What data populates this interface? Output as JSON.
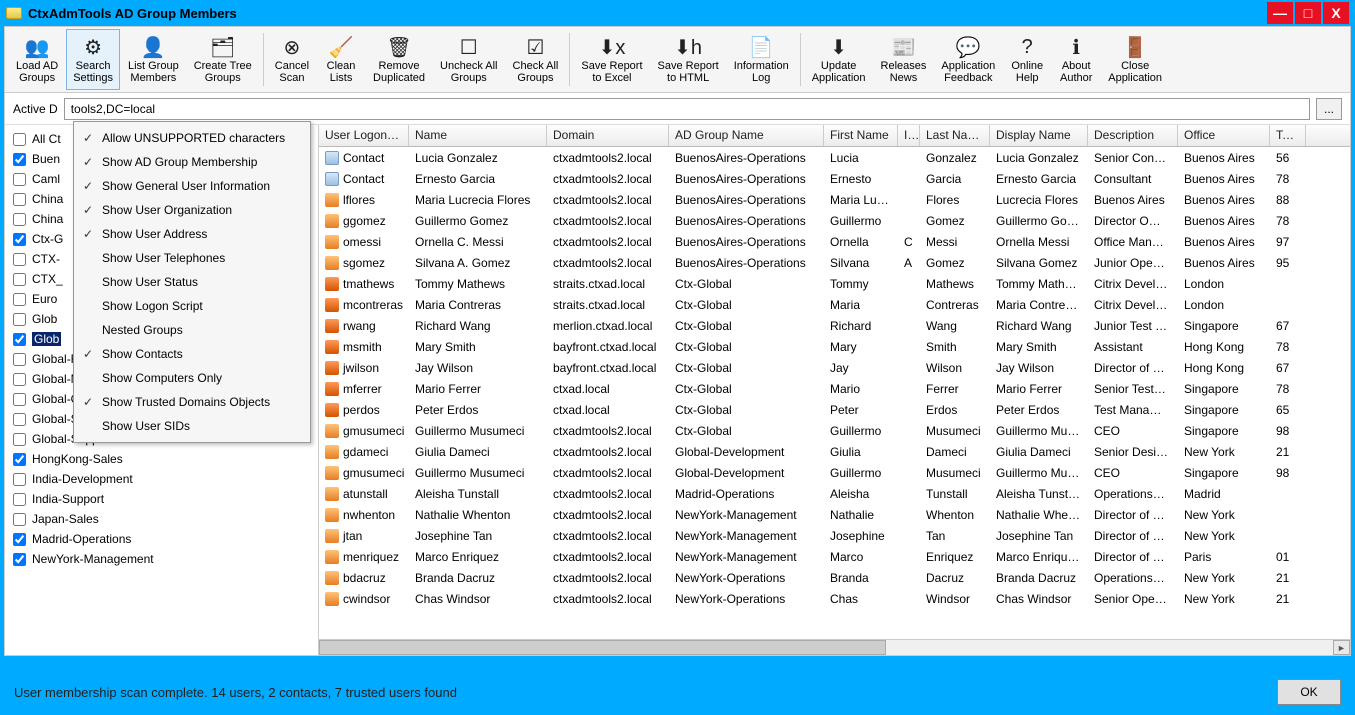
{
  "window": {
    "title": "CtxAdmTools AD Group Members",
    "minimize": "—",
    "maximize": "□",
    "close": "X"
  },
  "toolbar": [
    {
      "icon": "👥",
      "label": "Load AD\nGroups",
      "name": "load-ad-groups-button",
      "active": false
    },
    {
      "icon": "⚙",
      "label": "Search\nSettings",
      "name": "search-settings-button",
      "active": true
    },
    {
      "icon": "👤",
      "label": "List Group\nMembers",
      "name": "list-group-members-button"
    },
    {
      "icon": "🗂",
      "label": "Create Tree\nGroups",
      "name": "create-tree-groups-button"
    },
    {
      "sep": true
    },
    {
      "icon": "⊗",
      "label": "Cancel\nScan",
      "name": "cancel-scan-button"
    },
    {
      "icon": "🧹",
      "label": "Clean\nLists",
      "name": "clean-lists-button"
    },
    {
      "icon": "🗑",
      "label": "Remove\nDuplicated",
      "name": "remove-duplicated-button"
    },
    {
      "icon": "☐",
      "label": "Uncheck All\nGroups",
      "name": "uncheck-all-groups-button"
    },
    {
      "icon": "☑",
      "label": "Check All\nGroups",
      "name": "check-all-groups-button"
    },
    {
      "sep": true
    },
    {
      "icon": "⬇x",
      "label": "Save Report\nto Excel",
      "name": "save-report-excel-button"
    },
    {
      "icon": "⬇h",
      "label": "Save Report\nto HTML",
      "name": "save-report-html-button"
    },
    {
      "icon": "📄",
      "label": "Information\nLog",
      "name": "information-log-button"
    },
    {
      "sep": true
    },
    {
      "icon": "⬇",
      "label": "Update\nApplication",
      "name": "update-application-button"
    },
    {
      "icon": "📰",
      "label": "Releases\nNews",
      "name": "releases-news-button"
    },
    {
      "icon": "💬",
      "label": "Application\nFeedback",
      "name": "application-feedback-button"
    },
    {
      "icon": "?",
      "label": "Online\nHelp",
      "name": "online-help-button"
    },
    {
      "icon": "ℹ",
      "label": "About\nAuthor",
      "name": "about-author-button"
    },
    {
      "icon": "🚪",
      "label": "Close\nApplication",
      "name": "close-application-button"
    }
  ],
  "path": {
    "label": "Active D",
    "value_visible": "tools2,DC=local",
    "more": "..."
  },
  "dropdown": [
    {
      "checked": true,
      "label": "Allow UNSUPPORTED characters"
    },
    {
      "checked": true,
      "label": "Show AD Group Membership"
    },
    {
      "checked": true,
      "label": "Show General User Information"
    },
    {
      "checked": true,
      "label": "Show User Organization"
    },
    {
      "checked": true,
      "label": "Show User Address"
    },
    {
      "checked": false,
      "label": "Show User Telephones"
    },
    {
      "checked": false,
      "label": "Show User Status"
    },
    {
      "checked": false,
      "label": "Show Logon Script"
    },
    {
      "checked": false,
      "label": "Nested Groups"
    },
    {
      "checked": true,
      "label": "Show Contacts"
    },
    {
      "checked": false,
      "label": "Show Computers Only"
    },
    {
      "checked": true,
      "label": "Show Trusted Domains Objects"
    },
    {
      "checked": false,
      "label": "Show User SIDs"
    }
  ],
  "groups": [
    {
      "checked": false,
      "label": "All Ct",
      "partial": true
    },
    {
      "checked": true,
      "label": "Buen",
      "partial": true
    },
    {
      "checked": false,
      "label": "Caml",
      "partial": true
    },
    {
      "checked": false,
      "label": "China",
      "partial": true
    },
    {
      "checked": false,
      "label": "China",
      "partial": true
    },
    {
      "checked": true,
      "label": "Ctx-G",
      "partial": true
    },
    {
      "checked": false,
      "label": "CTX-",
      "partial": true
    },
    {
      "checked": false,
      "label": "CTX_",
      "partial": true
    },
    {
      "checked": false,
      "label": "Euro",
      "partial": true
    },
    {
      "checked": false,
      "label": "Glob",
      "partial": true
    },
    {
      "checked": true,
      "label": "Glob",
      "partial": true,
      "selected": true
    },
    {
      "checked": false,
      "label": "Global-Financial"
    },
    {
      "checked": false,
      "label": "Global-Management"
    },
    {
      "checked": false,
      "label": "Global-Operations"
    },
    {
      "checked": false,
      "label": "Global-Sales"
    },
    {
      "checked": false,
      "label": "Global-Support"
    },
    {
      "checked": true,
      "label": "HongKong-Sales"
    },
    {
      "checked": false,
      "label": "India-Development"
    },
    {
      "checked": false,
      "label": "India-Support"
    },
    {
      "checked": false,
      "label": "Japan-Sales"
    },
    {
      "checked": true,
      "label": "Madrid-Operations"
    },
    {
      "checked": true,
      "label": "NewYork-Management"
    }
  ],
  "columns": [
    "User Logon…",
    "Name",
    "Domain",
    "AD Group Name",
    "First Name",
    "I…",
    "Last Na…",
    "Display Name",
    "Description",
    "Office",
    "Te…"
  ],
  "rows": [
    {
      "type": "contact",
      "cells": [
        "Contact",
        "Lucia Gonzalez",
        "ctxadmtools2.local",
        "BuenosAires-Operations",
        "Lucia",
        "",
        "Gonzalez",
        "Lucia Gonzalez",
        "Senior Con…",
        "Buenos Aires",
        "56"
      ]
    },
    {
      "type": "contact",
      "cells": [
        "Contact",
        "Ernesto Garcia",
        "ctxadmtools2.local",
        "BuenosAires-Operations",
        "Ernesto",
        "",
        "Garcia",
        "Ernesto Garcia",
        "Consultant",
        "Buenos Aires",
        "78"
      ]
    },
    {
      "type": "user",
      "cells": [
        "lflores",
        "Maria Lucrecia Flores",
        "ctxadmtools2.local",
        "BuenosAires-Operations",
        "Maria Lucr…",
        "",
        "Flores",
        "Lucrecia Flores",
        "Buenos Aires",
        "Buenos Aires",
        "88"
      ]
    },
    {
      "type": "user",
      "cells": [
        "ggomez",
        "Guillermo Gomez",
        "ctxadmtools2.local",
        "BuenosAires-Operations",
        "Guillermo",
        "",
        "Gomez",
        "Guillermo Go…",
        "Director O…",
        "Buenos Aires",
        "78"
      ]
    },
    {
      "type": "user",
      "cells": [
        "omessi",
        "Ornella C. Messi",
        "ctxadmtools2.local",
        "BuenosAires-Operations",
        "Ornella",
        "C",
        "Messi",
        "Ornella Messi",
        "Office Man…",
        "Buenos Aires",
        "97"
      ]
    },
    {
      "type": "user",
      "cells": [
        "sgomez",
        "Silvana A. Gomez",
        "ctxadmtools2.local",
        "BuenosAires-Operations",
        "Silvana",
        "A",
        "Gomez",
        "Silvana Gomez",
        "Junior Ope…",
        "Buenos Aires",
        "95"
      ]
    },
    {
      "type": "trusted",
      "cells": [
        "tmathews",
        "Tommy Mathews",
        "straits.ctxad.local",
        "Ctx-Global",
        "Tommy",
        "",
        "Mathews",
        "Tommy Math…",
        "Citrix Devel…",
        "London",
        ""
      ]
    },
    {
      "type": "trusted",
      "cells": [
        "mcontreras",
        "Maria Contreras",
        "straits.ctxad.local",
        "Ctx-Global",
        "Maria",
        "",
        "Contreras",
        "Maria Contre…",
        "Citrix Devel…",
        "London",
        ""
      ]
    },
    {
      "type": "trusted",
      "cells": [
        "rwang",
        "Richard Wang",
        "merlion.ctxad.local",
        "Ctx-Global",
        "Richard",
        "",
        "Wang",
        "Richard Wang",
        "Junior Test …",
        "Singapore",
        "67"
      ]
    },
    {
      "type": "trusted",
      "cells": [
        "msmith",
        "Mary Smith",
        "bayfront.ctxad.local",
        "Ctx-Global",
        "Mary",
        "",
        "Smith",
        "Mary Smith",
        "Assistant",
        "Hong Kong",
        "78"
      ]
    },
    {
      "type": "trusted",
      "cells": [
        "jwilson",
        "Jay Wilson",
        "bayfront.ctxad.local",
        "Ctx-Global",
        "Jay",
        "",
        "Wilson",
        "Jay Wilson",
        "Director of …",
        "Hong Kong",
        "67"
      ]
    },
    {
      "type": "trusted",
      "cells": [
        "mferrer",
        "Mario Ferrer",
        "ctxad.local",
        "Ctx-Global",
        "Mario",
        "",
        "Ferrer",
        "Mario Ferrer",
        "Senior Test…",
        "Singapore",
        "78"
      ]
    },
    {
      "type": "trusted",
      "cells": [
        "perdos",
        "Peter Erdos",
        "ctxad.local",
        "Ctx-Global",
        "Peter",
        "",
        "Erdos",
        "Peter Erdos",
        "Test Mana…",
        "Singapore",
        "65"
      ]
    },
    {
      "type": "user",
      "cells": [
        "gmusumeci",
        "Guillermo Musumeci",
        "ctxadmtools2.local",
        "Ctx-Global",
        "Guillermo",
        "",
        "Musumeci",
        "Guillermo Mu…",
        "CEO",
        "Singapore",
        "98"
      ]
    },
    {
      "type": "user",
      "cells": [
        "gdameci",
        "Giulia Dameci",
        "ctxadmtools2.local",
        "Global-Development",
        "Giulia",
        "",
        "Dameci",
        "Giulia Dameci",
        "Senior Desi…",
        "New York",
        "21"
      ]
    },
    {
      "type": "user",
      "cells": [
        "gmusumeci",
        "Guillermo Musumeci",
        "ctxadmtools2.local",
        "Global-Development",
        "Guillermo",
        "",
        "Musumeci",
        "Guillermo Mu…",
        "CEO",
        "Singapore",
        "98"
      ]
    },
    {
      "type": "user",
      "cells": [
        "atunstall",
        "Aleisha Tunstall",
        "ctxadmtools2.local",
        "Madrid-Operations",
        "Aleisha",
        "",
        "Tunstall",
        "Aleisha Tunst…",
        "Operations…",
        "Madrid",
        ""
      ]
    },
    {
      "type": "user",
      "cells": [
        "nwhenton",
        "Nathalie Whenton",
        "ctxadmtools2.local",
        "NewYork-Management",
        "Nathalie",
        "",
        "Whenton",
        "Nathalie Whe…",
        "Director of …",
        "New York",
        ""
      ]
    },
    {
      "type": "user",
      "cells": [
        "jtan",
        "Josephine Tan",
        "ctxadmtools2.local",
        "NewYork-Management",
        "Josephine",
        "",
        "Tan",
        "Josephine Tan",
        "Director of …",
        "New York",
        ""
      ]
    },
    {
      "type": "user",
      "cells": [
        "menriquez",
        "Marco Enriquez",
        "ctxadmtools2.local",
        "NewYork-Management",
        "Marco",
        "",
        "Enriquez",
        "Marco Enriqu…",
        "Director of …",
        "Paris",
        "01"
      ]
    },
    {
      "type": "user",
      "cells": [
        "bdacruz",
        "Branda Dacruz",
        "ctxadmtools2.local",
        "NewYork-Operations",
        "Branda",
        "",
        "Dacruz",
        "Branda Dacruz",
        "Operations…",
        "New York",
        "21"
      ]
    },
    {
      "type": "user",
      "cells": [
        "cwindsor",
        "Chas Windsor",
        "ctxadmtools2.local",
        "NewYork-Operations",
        "Chas",
        "",
        "Windsor",
        "Chas Windsor",
        "Senior Ope…",
        "New York",
        "21"
      ]
    }
  ],
  "status": {
    "text": "User membership scan complete. 14 users, 2 contacts, 7 trusted users found",
    "ok": "OK"
  }
}
